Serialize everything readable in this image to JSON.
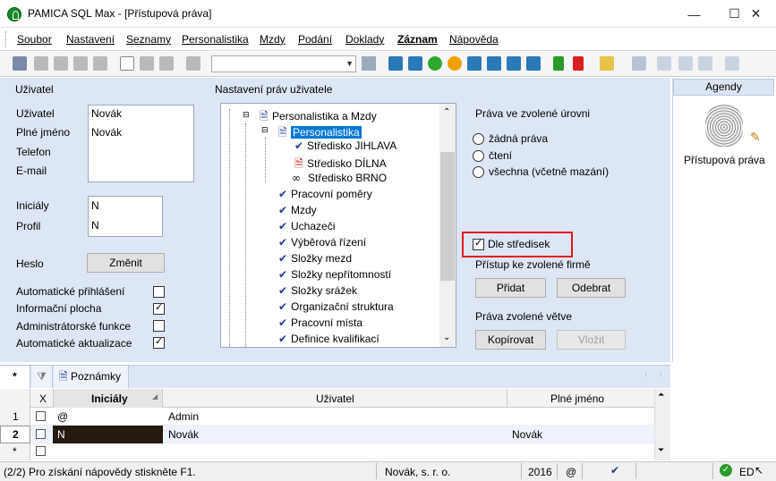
{
  "window": {
    "title": "PAMICA SQL Max - [Přístupová práva]",
    "minimize": "—",
    "maximize": "☐",
    "close": "✕"
  },
  "menu": [
    "Soubor",
    "Nastavení",
    "Seznamy",
    "Personalistika",
    "Mzdy",
    "Podání",
    "Doklady",
    "Záznam",
    "Nápověda"
  ],
  "left_panel": {
    "title": "Uživatel",
    "fields": {
      "user_label": "Uživatel",
      "user_value": "Novák",
      "fullname_label": "Plné jméno",
      "fullname_value": "Novák",
      "phone_label": "Telefon",
      "email_label": "E-mail",
      "initials_label": "Iniciály",
      "initials_value": "N",
      "profile_label": "Profil",
      "profile_value": "N",
      "password_label": "Heslo",
      "change_button": "Změnit"
    },
    "checkboxes": [
      {
        "label": "Automatické přihlášení",
        "checked": false
      },
      {
        "label": "Informační plocha",
        "checked": true
      },
      {
        "label": "Administrátorské funkce",
        "checked": false
      },
      {
        "label": "Automatické aktualizace",
        "checked": true
      }
    ]
  },
  "rights_panel": {
    "title": "Nastavení práv uživatele",
    "tree": [
      {
        "label": "Personalistika a Mzdy",
        "icon": "document-icon",
        "level": 0
      },
      {
        "label": "Personalistika",
        "icon": "document-icon",
        "level": 1,
        "selected": true
      },
      {
        "label": "Středisko JIHLAVA",
        "icon": "check-icon",
        "level": 2
      },
      {
        "label": "Středisko DÍLNA",
        "icon": "document-red-icon",
        "level": 2
      },
      {
        "label": "Středisko BRNO",
        "icon": "glasses-icon",
        "level": 2
      },
      {
        "label": "Pracovní poměry",
        "icon": "check-icon",
        "level": 1
      },
      {
        "label": "Mzdy",
        "icon": "check-icon",
        "level": 1
      },
      {
        "label": "Uchazeči",
        "icon": "check-icon",
        "level": 1
      },
      {
        "label": "Výběrová řízení",
        "icon": "check-icon",
        "level": 1
      },
      {
        "label": "Složky mezd",
        "icon": "check-icon",
        "level": 1
      },
      {
        "label": "Složky nepřítomností",
        "icon": "check-icon",
        "level": 1
      },
      {
        "label": "Složky srážek",
        "icon": "check-icon",
        "level": 1
      },
      {
        "label": "Organizační struktura",
        "icon": "check-icon",
        "level": 1
      },
      {
        "label": "Pracovní místa",
        "icon": "check-icon",
        "level": 1
      },
      {
        "label": "Definice kvalifikací",
        "icon": "check-icon",
        "level": 1
      }
    ],
    "level_title": "Práva ve zvolené úrovni",
    "radios": [
      "žádná práva",
      "čtení",
      "všechna (včetně mazání)"
    ],
    "by_center": {
      "label": "Dle středisek",
      "checked": true
    },
    "firm_title": "Přístup ke zvolené firmě",
    "add_button": "Přidat",
    "remove_button": "Odebrat",
    "branch_title": "Práva zvolené větve",
    "copy_button": "Kopírovat",
    "paste_button": "Vložit"
  },
  "agenda": {
    "title": "Agendy",
    "item_label": "Přístupová práva"
  },
  "tabs": {
    "star": "*",
    "notes": "Poznámky"
  },
  "grid": {
    "headers": {
      "x": "X",
      "initials": "Iniciály",
      "user": "Uživatel",
      "fullname": "Plné jméno"
    },
    "rows": [
      {
        "num": "1",
        "initials": "@",
        "user": "Admin",
        "fullname": ""
      },
      {
        "num": "2",
        "initials": "N",
        "user": "Novák",
        "fullname": "Novák"
      },
      {
        "num": "*",
        "initials": "",
        "user": "",
        "fullname": ""
      }
    ]
  },
  "status": {
    "help": "(2/2) Pro získání nápovědy stiskněte F1.",
    "company": "Novák, s. r. o.",
    "year": "2016",
    "at": "@",
    "ed": "ED"
  },
  "colors": {
    "accent": "#0078d7",
    "highlight": "#e01818",
    "panel": "#dde6f4"
  }
}
